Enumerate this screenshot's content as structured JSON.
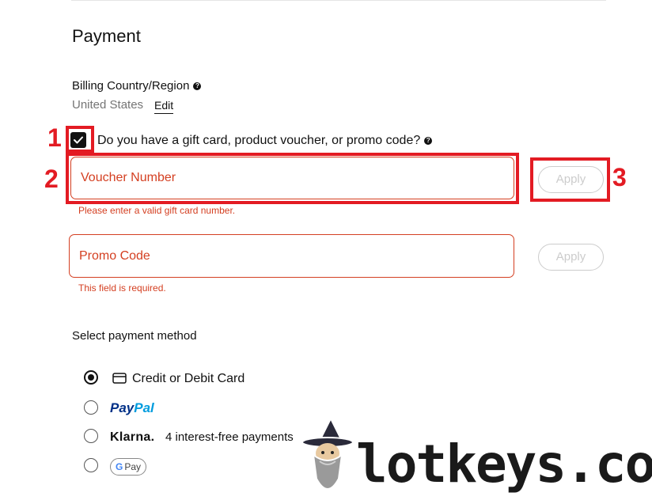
{
  "page": {
    "title": "Payment"
  },
  "billing": {
    "label": "Billing Country/Region",
    "country": "United States",
    "edit_label": "Edit"
  },
  "gift": {
    "question": "Do you have a gift card, product voucher, or promo code?",
    "checked": true
  },
  "voucher": {
    "placeholder": "Voucher Number",
    "error": "Please enter a valid gift card number.",
    "apply_label": "Apply"
  },
  "promo": {
    "placeholder": "Promo Code",
    "error": "This field is required.",
    "apply_label": "Apply"
  },
  "payment_method": {
    "label": "Select payment method",
    "options": [
      {
        "label": "Credit or Debit Card",
        "icon": "credit-card-icon",
        "selected": true
      },
      {
        "brand_a": "Pay",
        "brand_b": "Pal",
        "selected": false
      },
      {
        "brand": "Klarna.",
        "label": "4 interest-free payments",
        "selected": false
      },
      {
        "g": "G",
        "label": "Pay",
        "selected": false
      }
    ]
  },
  "annotations": {
    "n1": "1",
    "n2": "2",
    "n3": "3"
  },
  "watermark": {
    "text": "lotkeys.com"
  },
  "colors": {
    "error": "#d43f21",
    "annotation": "#e31b23",
    "disabled": "#cccccc"
  }
}
